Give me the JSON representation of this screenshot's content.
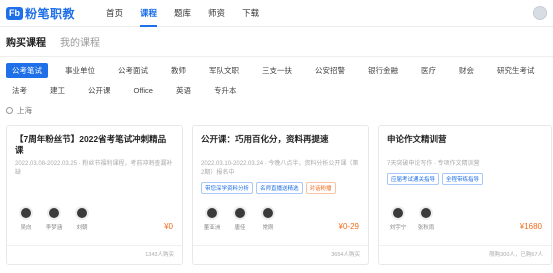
{
  "brand": {
    "mark": "Fb",
    "name": "粉笔职教"
  },
  "nav": [
    {
      "label": "首页",
      "active": false
    },
    {
      "label": "课程",
      "active": true
    },
    {
      "label": "题库",
      "active": false
    },
    {
      "label": "师资",
      "active": false
    },
    {
      "label": "下载",
      "active": false
    }
  ],
  "subtabs": [
    {
      "label": "购买课程",
      "active": true
    },
    {
      "label": "我的课程",
      "active": false
    }
  ],
  "filters": {
    "row1": [
      {
        "label": "公考笔试",
        "selected": true
      },
      {
        "label": "事业单位"
      },
      {
        "label": "公考面试"
      },
      {
        "label": "教师"
      },
      {
        "label": "军队文职"
      },
      {
        "label": "三支一扶"
      },
      {
        "label": "公安招警"
      },
      {
        "label": "银行金融"
      },
      {
        "label": "医疗"
      },
      {
        "label": "财会"
      },
      {
        "label": "研究生考试"
      }
    ],
    "row2": [
      {
        "label": "法考"
      },
      {
        "label": "建工"
      },
      {
        "label": "公开课"
      },
      {
        "label": "Office"
      },
      {
        "label": "英语"
      },
      {
        "label": "专升本"
      }
    ]
  },
  "location": "上海",
  "cards": [
    {
      "title": "【7周年粉丝节】2022省考笔试冲刺精品课",
      "date": "2022.03.08-2022.03.25 · 粉丝节福利课程，考前冲刺查漏补缺",
      "tags": [],
      "teachers": [
        "吴向",
        "李梦涵",
        "刘朝"
      ],
      "price": "¥0",
      "buyers": "1343人购买"
    },
    {
      "title": "公开课：巧用百化分，资料再提速",
      "date": "2022.03.10-2022.03.24 · 今晚八点半，资料分析公开课（第2期）报名中",
      "tags": [
        {
          "label": "带您深学资料分析",
          "color": "#1e6fe8"
        },
        {
          "label": "名师直播送精选",
          "color": "#1e6fe8"
        },
        {
          "label": "对话粉播",
          "color": "#f26b1d"
        }
      ],
      "teachers": [
        "董亚洲",
        "唐佳",
        "常刚"
      ],
      "price": "¥0-29",
      "buyers": "3654人购买"
    },
    {
      "title": "申论作文精训营",
      "date": "7天突破申论写作 · 专项作文精训营",
      "tags": [
        {
          "label": "应届考试通关指导",
          "color": "#1e6fe8"
        },
        {
          "label": "全程带练指导",
          "color": "#1e6fe8"
        }
      ],
      "teachers": [
        "刘宇宁",
        "张秋雨"
      ],
      "price": "¥1680",
      "buyers": "限购300人，已购67人"
    }
  ],
  "colors": {
    "accent": "#1e6fe8",
    "price": "#f26b1d"
  }
}
